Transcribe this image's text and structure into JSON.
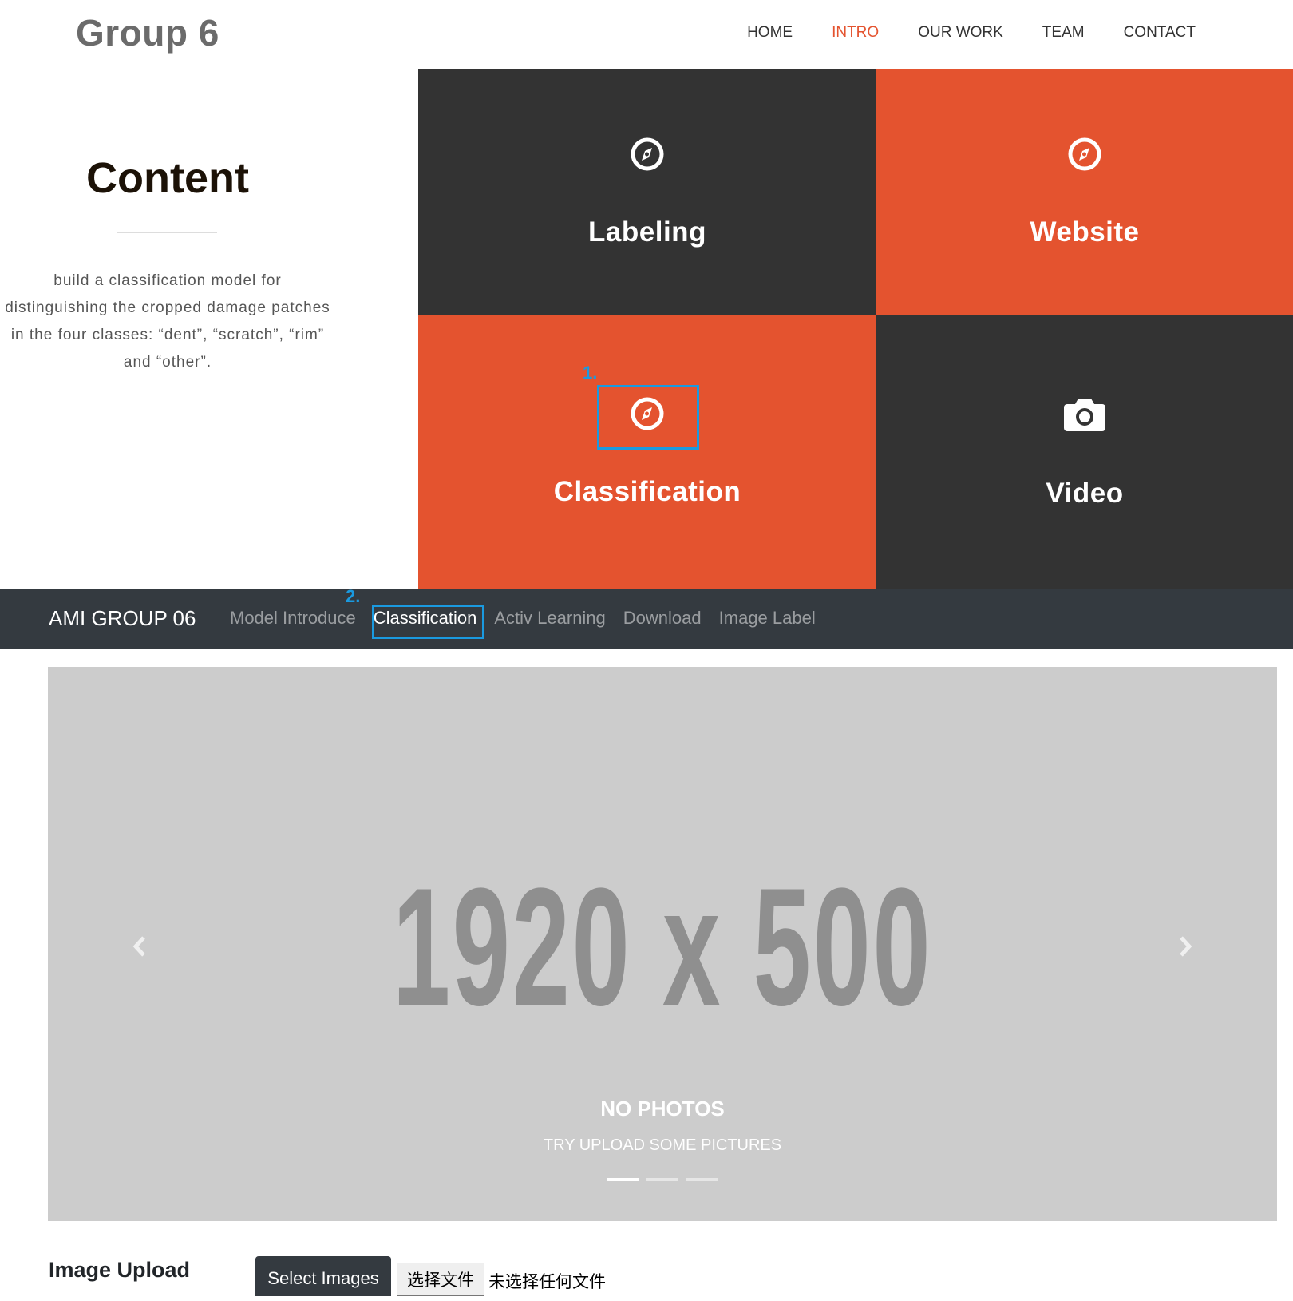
{
  "header": {
    "brand": "Group 6",
    "nav": [
      "HOME",
      "INTRO",
      "OUR WORK",
      "TEAM",
      "CONTACT"
    ],
    "active_nav": "INTRO",
    "accent_color": "#e4532f"
  },
  "intro": {
    "title": "Content",
    "description_lines": [
      "build a classification model for",
      "distinguishing the cropped damage patches",
      "in the four classes: “dent”, “scratch”, “rim”",
      "and “other”."
    ]
  },
  "tiles": [
    {
      "label": "Labeling",
      "icon": "compass-icon",
      "style": "dark"
    },
    {
      "label": "Website",
      "icon": "compass-icon",
      "style": "orange"
    },
    {
      "label": "Classification",
      "icon": "compass-icon",
      "style": "orange"
    },
    {
      "label": "Video",
      "icon": "camera-icon",
      "style": "dark"
    }
  ],
  "annotations": [
    "1.",
    "2."
  ],
  "app_nav": {
    "brand": "AMI GROUP 06",
    "items": [
      "Model Introduce",
      "Classification",
      "Activ Learning",
      "Download",
      "Image Label"
    ],
    "active": "Classification"
  },
  "carousel": {
    "placeholder": "1920 x 500",
    "caption_title": "NO PHOTOS",
    "caption_subtitle": "TRY UPLOAD SOME PICTURES",
    "slide_count": 3,
    "active_slide": 1
  },
  "upload": {
    "label": "Image Upload",
    "select_button": "Select Images",
    "file_button": "选择文件",
    "file_status": "未选择任何文件"
  }
}
